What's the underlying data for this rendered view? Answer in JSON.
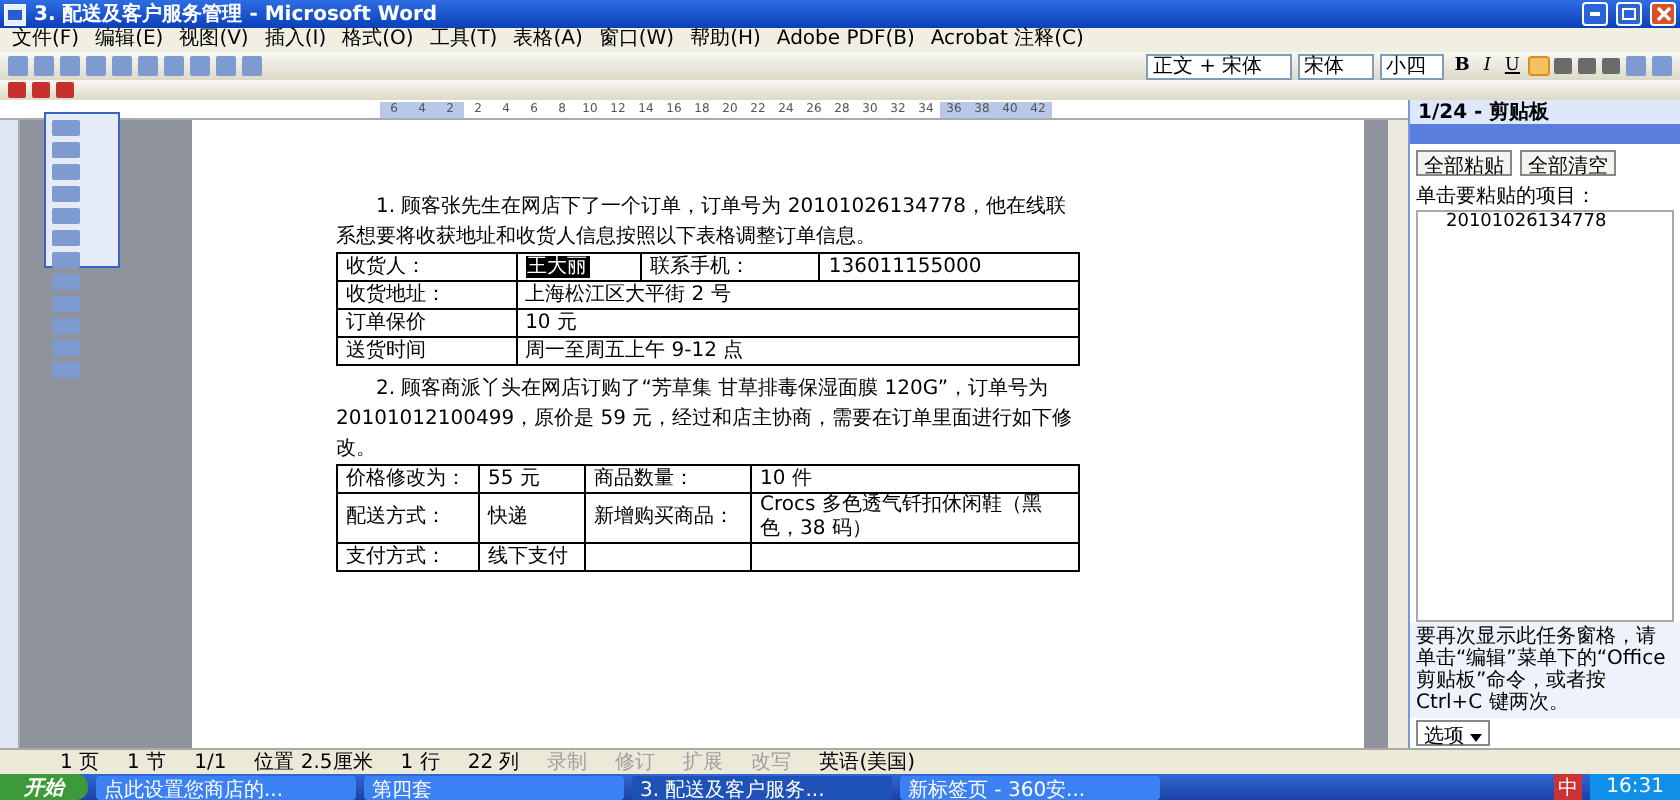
{
  "window": {
    "title": "3. 配送及客户服务管理 - Microsoft Word"
  },
  "menu": [
    "文件(F)",
    "编辑(E)",
    "视图(V)",
    "插入(I)",
    "格式(O)",
    "工具(T)",
    "表格(A)",
    "窗口(W)",
    "帮助(H)",
    "Adobe PDF(B)",
    "Acrobat 注释(C)"
  ],
  "formatting": {
    "style": "正文 + 宋体",
    "font": "宋体",
    "size": "小四",
    "buttons": [
      "B",
      "I",
      "U"
    ]
  },
  "ruler": {
    "marks": [
      "6",
      "4",
      "2",
      "2",
      "4",
      "6",
      "8",
      "10",
      "12",
      "14",
      "16",
      "18",
      "20",
      "22",
      "24",
      "26",
      "28",
      "30",
      "32",
      "34",
      "36",
      "38",
      "40",
      "42"
    ]
  },
  "document": {
    "paragraph_1": "1. 顾客张先生在网店下了一个订单，订单号为 20101026134778，他在线联系想要将收获地址和收货人信息按照以下表格调整订单信息。",
    "table_1": [
      [
        "收货人：",
        "王大丽",
        "联系手机：",
        "136011155000"
      ],
      [
        "收货地址：",
        "上海松江区大平街 2 号"
      ],
      [
        "订单保价",
        "10 元"
      ],
      [
        "送货时间",
        "周一至周五上午 9-12 点"
      ]
    ],
    "paragraph_2": "2. 顾客商派丫头在网店订购了“芳草集 甘草排毒保湿面膜 120G”，订单号为 20101012100499，原价是 59 元，经过和店主协商，需要在订单里面进行如下修改。",
    "table_2": [
      [
        "价格修改为：",
        "55 元",
        "商品数量：",
        "10 件"
      ],
      [
        "配送方式：",
        "快递",
        "新增购买商品：",
        "Crocs 多色透气钎扣休闲鞋（黑色，38 码）"
      ],
      [
        "支付方式：",
        "线下支付"
      ]
    ]
  },
  "task_pane": {
    "title": "1/24 - 剪贴板",
    "buttons": [
      "全部粘贴",
      "全部清空"
    ],
    "label": "单击要粘贴的项目：",
    "items": [
      "20101026134778"
    ],
    "hint": "要再次显示此任务窗格，请单击“编辑”菜单下的“Office 剪贴板”命令，或者按 Ctrl+C 键两次。",
    "options": "选项"
  },
  "status_bar": [
    {
      "text": "1 页",
      "disabled": false
    },
    {
      "text": "1 节",
      "disabled": false
    },
    {
      "text": "1/1",
      "disabled": false
    },
    {
      "text": "位置 2.5厘米",
      "disabled": false
    },
    {
      "text": "1 行",
      "disabled": false
    },
    {
      "text": "22 列",
      "disabled": false
    },
    {
      "text": "录制",
      "disabled": true
    },
    {
      "text": "修订",
      "disabled": true
    },
    {
      "text": "扩展",
      "disabled": true
    },
    {
      "text": "改写",
      "disabled": true
    },
    {
      "text": "英语(美国)",
      "disabled": false
    }
  ],
  "taskbar": {
    "start": "开始",
    "tasks": [
      {
        "label": "点此设置您商店的...",
        "selected": false
      },
      {
        "label": "第四套",
        "selected": false
      },
      {
        "label": "3. 配送及客户服务...",
        "selected": true
      },
      {
        "label": "新标签页 - 360安...",
        "selected": false
      }
    ],
    "ime": "中",
    "clock": "16:31"
  }
}
